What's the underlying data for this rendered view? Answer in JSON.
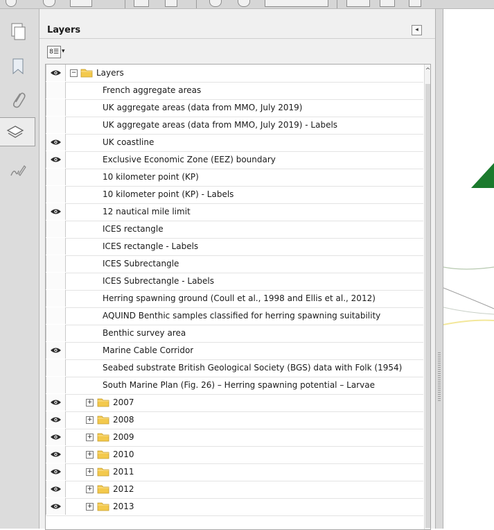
{
  "panel": {
    "title": "Layers",
    "collapse_glyph": "◂",
    "options_glyph": "8☰",
    "options_arrow": "▾"
  },
  "icons": {
    "visible": "eye-icon",
    "folder": "folder-icon",
    "expand": "plus-box-icon",
    "collapse": "minus-box-icon"
  },
  "colors": {
    "folder": "#f3c94c",
    "accent_green": "#1b7a2d"
  },
  "tree": {
    "root": {
      "label": "Layers",
      "visible": true,
      "expanded": true
    },
    "layers": [
      {
        "label": "French aggregate areas",
        "visible": false
      },
      {
        "label": "UK aggregate areas (data from MMO, July 2019)",
        "visible": false
      },
      {
        "label": "UK aggregate areas (data from MMO, July 2019) - Labels",
        "visible": false
      },
      {
        "label": "UK coastline",
        "visible": true
      },
      {
        "label": "Exclusive Economic Zone (EEZ) boundary",
        "visible": true
      },
      {
        "label": "10 kilometer point (KP)",
        "visible": false
      },
      {
        "label": "10 kilometer point (KP) - Labels",
        "visible": false
      },
      {
        "label": "12 nautical mile limit",
        "visible": true
      },
      {
        "label": "ICES rectangle",
        "visible": false
      },
      {
        "label": "ICES rectangle - Labels",
        "visible": false
      },
      {
        "label": "ICES Subrectangle",
        "visible": false
      },
      {
        "label": "ICES Subrectangle - Labels",
        "visible": false
      },
      {
        "label": "Herring spawning ground (Coull et al., 1998 and Ellis et al., 2012)",
        "visible": false
      },
      {
        "label": "AQUIND Benthic samples classified for herring spawning suitability",
        "visible": false
      },
      {
        "label": "Benthic survey area",
        "visible": false
      },
      {
        "label": "Marine Cable Corridor",
        "visible": true
      },
      {
        "label": "Seabed substrate British Geological Society (BGS) data with Folk (1954)",
        "visible": false
      },
      {
        "label": "South Marine Plan (Fig. 26) – Herring spawning potential – Larvae",
        "visible": false
      }
    ],
    "groups": [
      {
        "label": "2007",
        "visible": true
      },
      {
        "label": "2008",
        "visible": true
      },
      {
        "label": "2009",
        "visible": true
      },
      {
        "label": "2010",
        "visible": true
      },
      {
        "label": "2011",
        "visible": true
      },
      {
        "label": "2012",
        "visible": true
      },
      {
        "label": "2013",
        "visible": true
      }
    ]
  },
  "scrollbar": {
    "up_glyph": "^"
  }
}
